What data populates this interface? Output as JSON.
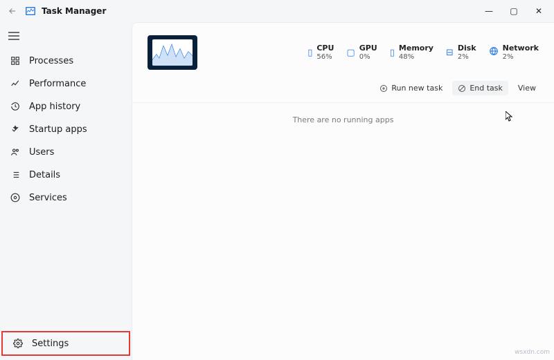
{
  "window": {
    "title": "Task Manager",
    "controls": {
      "min": "—",
      "max": "▢",
      "close": "✕"
    }
  },
  "sidebar": {
    "items": [
      {
        "label": "Processes"
      },
      {
        "label": "Performance"
      },
      {
        "label": "App history"
      },
      {
        "label": "Startup apps"
      },
      {
        "label": "Users"
      },
      {
        "label": "Details"
      },
      {
        "label": "Services"
      }
    ],
    "settings_label": "Settings"
  },
  "stats": {
    "cpu": {
      "label": "CPU",
      "value": "56%"
    },
    "gpu": {
      "label": "GPU",
      "value": "0%"
    },
    "memory": {
      "label": "Memory",
      "value": "48%"
    },
    "disk": {
      "label": "Disk",
      "value": "2%"
    },
    "network": {
      "label": "Network",
      "value": "2%"
    }
  },
  "actions": {
    "run_new_task": "Run new task",
    "end_task": "End task",
    "view": "View"
  },
  "content": {
    "empty": "There are no running apps"
  },
  "watermark": "wsxdn.com"
}
